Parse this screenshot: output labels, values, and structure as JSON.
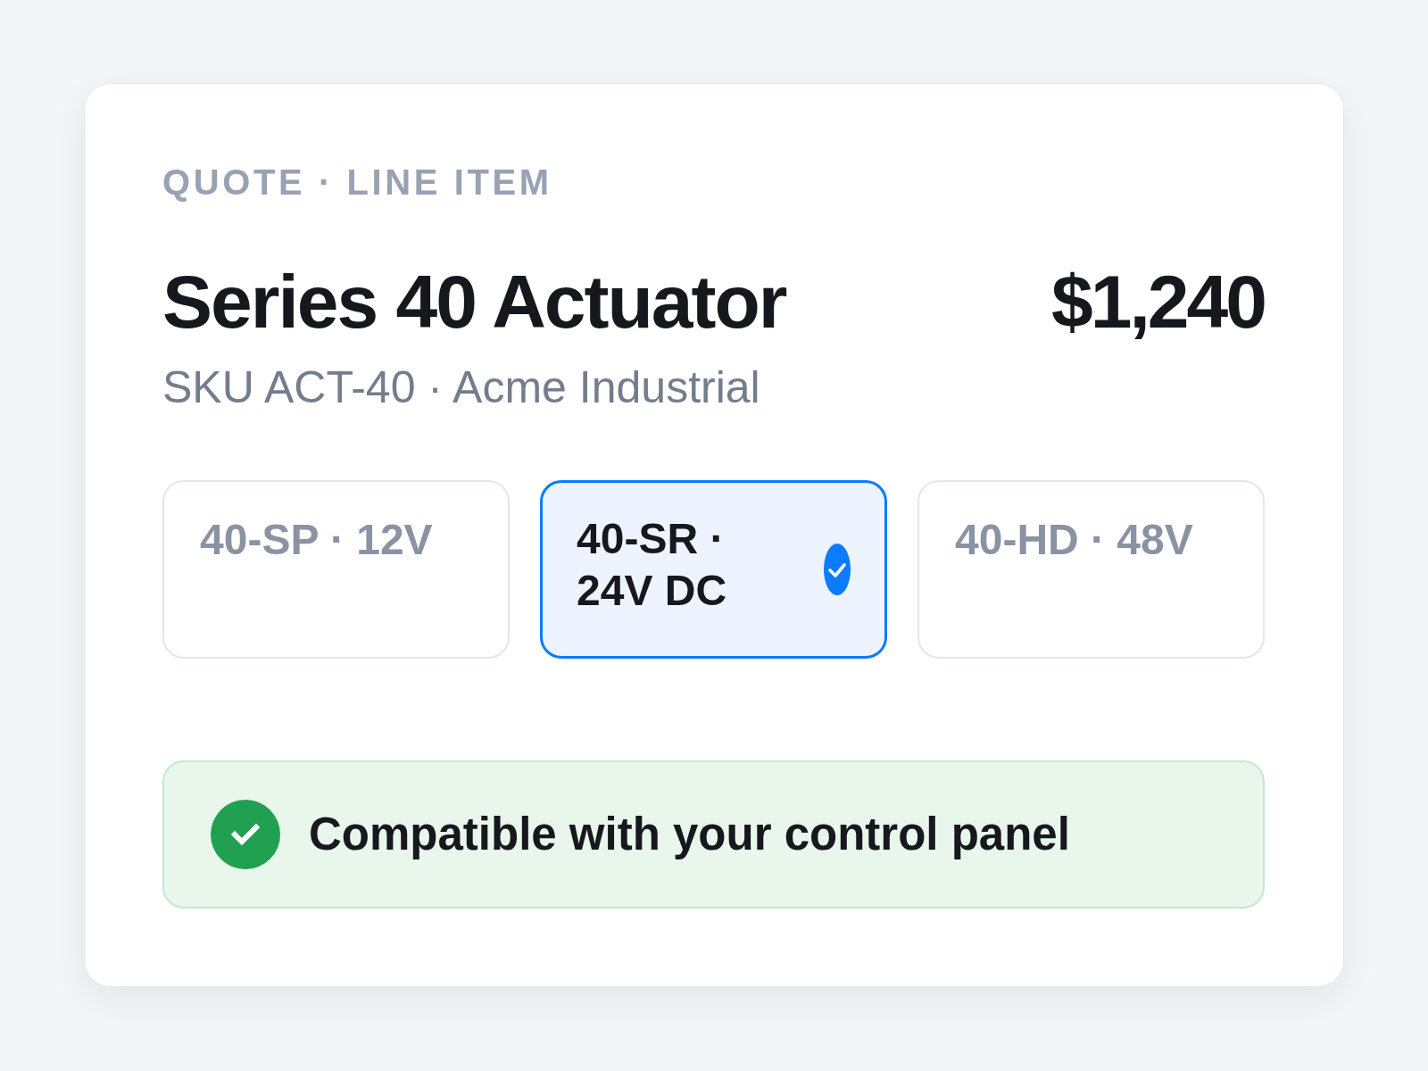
{
  "eyebrow": "QUOTE · LINE ITEM",
  "product": {
    "title": "Series 40 Actuator",
    "price": "$1,240",
    "subtitle": "SKU ACT-40 · Acme Industrial"
  },
  "options": [
    {
      "label": "40-SP · 12V",
      "selected": false
    },
    {
      "label": "40-SR · 24V DC",
      "selected": true
    },
    {
      "label": "40-HD · 48V",
      "selected": false
    }
  ],
  "compatibility": {
    "text": "Compatible with your control panel",
    "ok": true
  }
}
